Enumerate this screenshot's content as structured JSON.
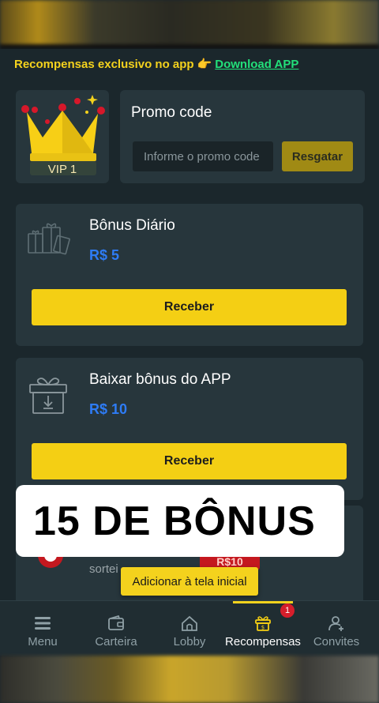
{
  "promo_strip": {
    "text": "Recompensas exclusivo no app",
    "hand_icon": "👉",
    "download_link": "Download APP"
  },
  "vip": {
    "label": "VIP 1",
    "icon": "crown-icon"
  },
  "promo_code": {
    "title": "Promo code",
    "placeholder": "Informe o promo code",
    "button": "Resgatar"
  },
  "bonuses": [
    {
      "title": "Bônus Diário",
      "amount": "R$ 5",
      "button": "Receber",
      "icon": "gifts-icon"
    },
    {
      "title": "Baixar bônus do APP",
      "amount": "R$ 10",
      "button": "Receber",
      "icon": "gift-download-icon"
    }
  ],
  "third_card": {
    "partial_text": "sortei",
    "badge": "R$10"
  },
  "add_home_button": "Adicionar à tela inicial",
  "overlay_banner": "15 DE BÔNUS",
  "nav": {
    "items": [
      {
        "label": "Menu",
        "icon": "menu-icon"
      },
      {
        "label": "Carteira",
        "icon": "wallet-icon"
      },
      {
        "label": "Lobby",
        "icon": "home-icon"
      },
      {
        "label": "Recompensas",
        "icon": "rewards-icon"
      },
      {
        "label": "Convites",
        "icon": "user-add-icon"
      }
    ],
    "active": "Recompensas",
    "badge": "1"
  },
  "colors": {
    "accent": "#f4cf14",
    "amount": "#2e7cf6",
    "link": "#22e07a",
    "background": "#1b272c"
  }
}
